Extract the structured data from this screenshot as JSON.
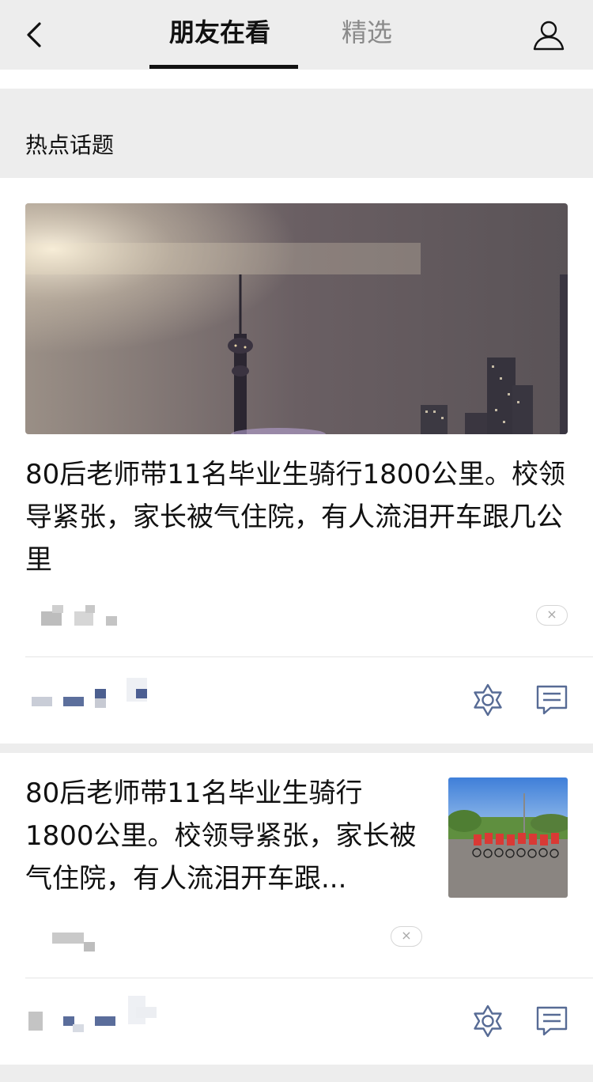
{
  "header": {
    "tabs": [
      {
        "label": "朋友在看",
        "active": true
      },
      {
        "label": "精选",
        "active": false
      }
    ]
  },
  "section": {
    "title": "热点话题"
  },
  "articles": [
    {
      "title": "80后老师带11名毕业生骑行1800公里。校领导紧张，家长被气住院，有人流泪开车跟几公里",
      "close_label": "×"
    },
    {
      "title": "80后老师带11名毕业生骑行1800公里。校领导紧张，家长被气住院，有人流泪开车跟...",
      "close_label": "×"
    }
  ],
  "icons": {
    "back": "chevron-left-icon",
    "profile": "person-icon",
    "wow": "wow-star-icon",
    "comment": "comment-icon"
  },
  "colors": {
    "accent": "#576b95",
    "text": "#111111",
    "muted": "#8a8a8a",
    "divider": "#e5e5e5",
    "background": "#ededed"
  }
}
